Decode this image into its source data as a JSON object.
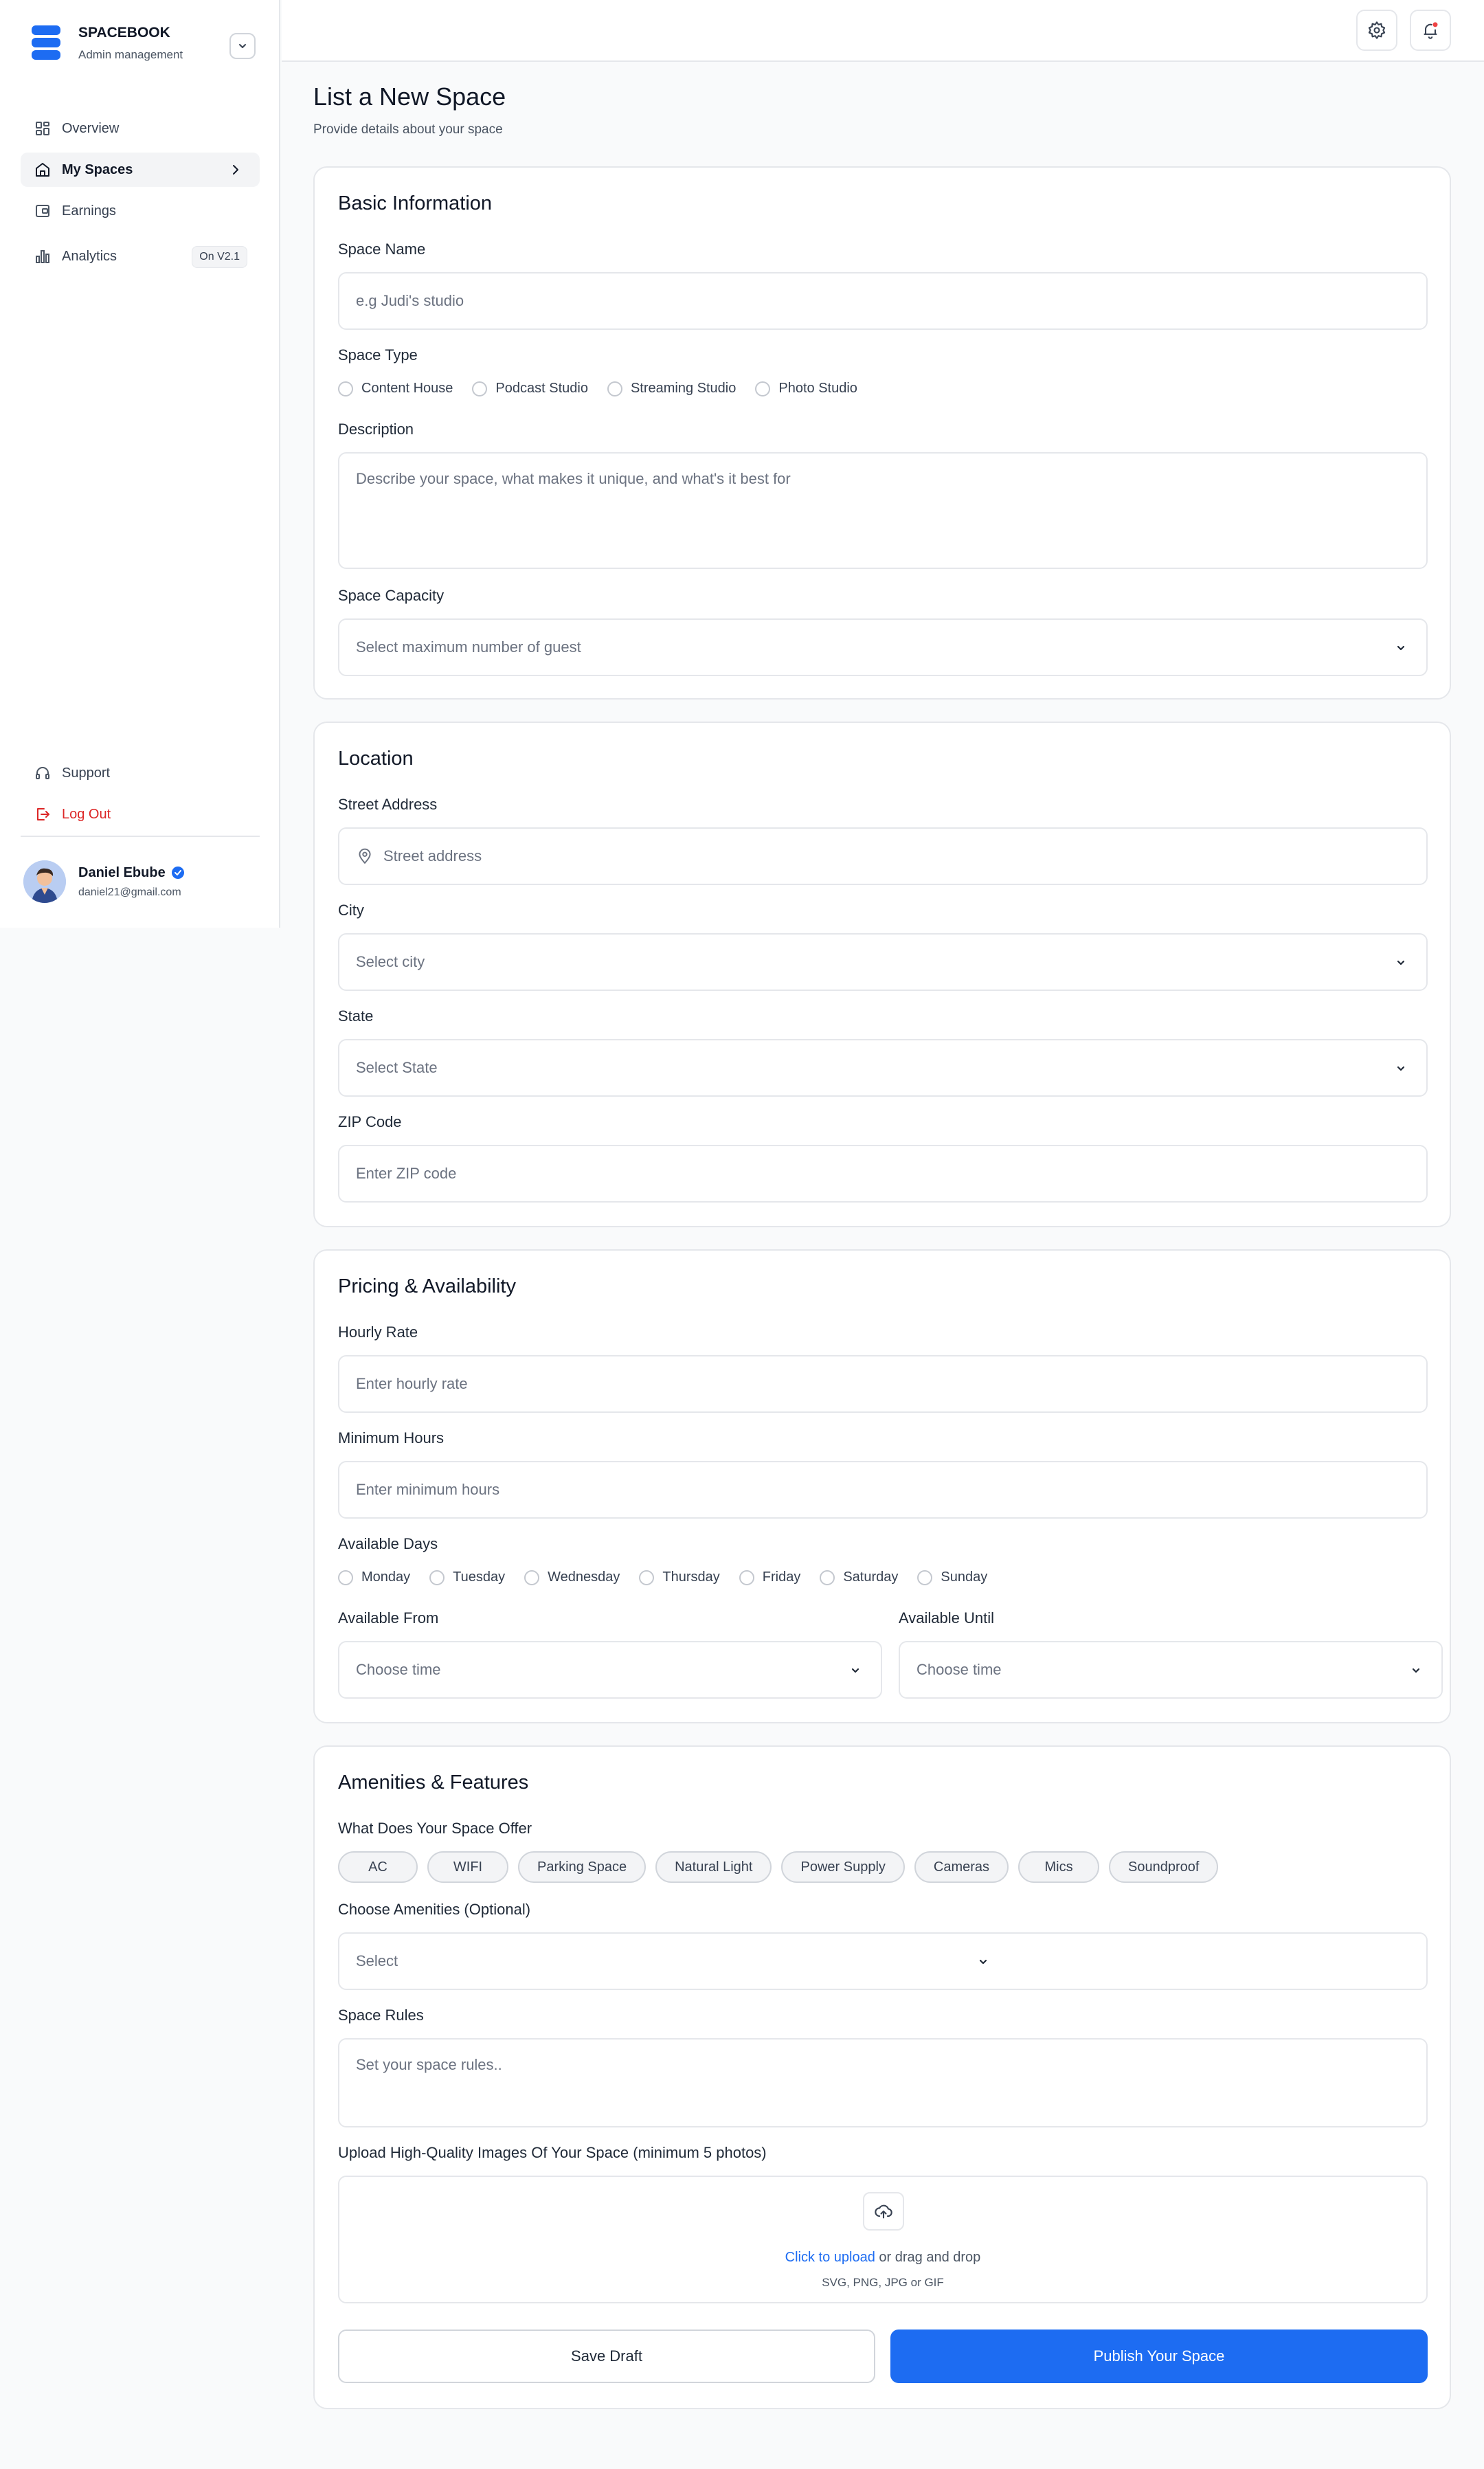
{
  "brand": {
    "name": "SPACEBOOK",
    "subtitle": "Admin management",
    "color": "#1d6cf2"
  },
  "sidebar": {
    "items": [
      {
        "label": "Overview",
        "icon": "grid-icon",
        "active": false
      },
      {
        "label": "My Spaces",
        "icon": "home-icon",
        "active": true
      },
      {
        "label": "Earnings",
        "icon": "wallet-icon",
        "active": false
      },
      {
        "label": "Analytics",
        "icon": "bar-chart-icon",
        "active": false,
        "badge": "On V2.1"
      }
    ],
    "support_label": "Support",
    "logout_label": "Log Out"
  },
  "user": {
    "name": "Daniel Ebube",
    "email": "daniel21@gmail.com",
    "verified": true
  },
  "header": {
    "title": "List a New Space",
    "subtitle": "Provide details about your space"
  },
  "basic": {
    "title": "Basic Information",
    "space_name_label": "Space Name",
    "space_name_placeholder": "e.g Judi's studio",
    "space_type_label": "Space Type",
    "space_types": [
      "Content House",
      "Podcast Studio",
      "Streaming Studio",
      "Photo Studio"
    ],
    "description_label": "Description",
    "description_placeholder": "Describe your space, what makes it unique, and what's it best for",
    "capacity_label": "Space Capacity",
    "capacity_placeholder": "Select maximum number of guest"
  },
  "location": {
    "title": "Location",
    "street_label": "Street Address",
    "street_placeholder": "Street address",
    "city_label": "City",
    "city_placeholder": "Select city",
    "state_label": "State",
    "state_placeholder": "Select State",
    "zip_label": "ZIP Code",
    "zip_placeholder": "Enter ZIP code"
  },
  "pricing": {
    "title": "Pricing & Availability",
    "hourly_label": "Hourly Rate",
    "hourly_placeholder": "Enter hourly rate",
    "min_hours_label": "Minimum Hours",
    "min_hours_placeholder": "Enter minimum hours",
    "days_label": "Available Days",
    "days": [
      "Monday",
      "Tuesday",
      "Wednesday",
      "Thursday",
      "Friday",
      "Saturday",
      "Sunday"
    ],
    "from_label": "Available From",
    "from_placeholder": "Choose time",
    "until_label": "Available Until",
    "until_placeholder": "Choose time"
  },
  "amenities": {
    "title": "Amenities & Features",
    "offer_label": "What Does Your Space Offer",
    "offers": [
      "AC",
      "WIFI",
      "Parking Space",
      "Natural Light",
      "Power Supply",
      "Cameras",
      "Mics",
      "Soundproof"
    ],
    "choose_label": "Choose Amenities (Optional)",
    "choose_placeholder": "Select",
    "rules_label": "Space Rules",
    "rules_placeholder": "Set your space rules..",
    "upload_label": "Upload High-Quality Images Of Your Space (minimum 5 photos)",
    "upload_link": "Click to upload",
    "upload_text": "or drag and drop",
    "upload_types": "SVG, PNG, JPG or GIF",
    "save_draft": "Save Draft",
    "publish": "Publish Your Space"
  }
}
